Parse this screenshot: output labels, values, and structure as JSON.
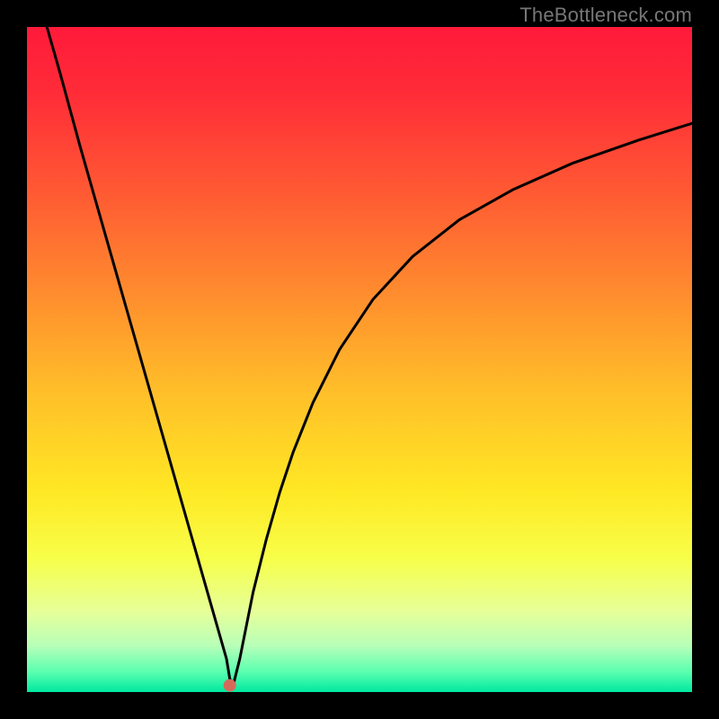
{
  "watermark": "TheBottleneck.com",
  "chart_data": {
    "type": "line",
    "title": "",
    "xlabel": "",
    "ylabel": "",
    "xlim": [
      0,
      100
    ],
    "ylim": [
      0,
      100
    ],
    "x": [
      3,
      5,
      8,
      10,
      12,
      15,
      18,
      20,
      22,
      25,
      27,
      28,
      29,
      30,
      30.5,
      31,
      32,
      34,
      36,
      38,
      40,
      43,
      47,
      52,
      58,
      65,
      73,
      82,
      92,
      100
    ],
    "values": [
      100,
      93,
      82,
      75,
      68,
      57.5,
      47,
      40,
      33,
      22.5,
      15.5,
      12,
      8.5,
      5,
      2,
      1,
      5,
      15,
      23,
      30,
      36,
      43.5,
      51.5,
      59,
      65.5,
      71,
      75.5,
      79.5,
      83,
      85.5
    ],
    "marker": {
      "x": 30.5,
      "y": 1,
      "color": "#d46b5a"
    },
    "gradient_stops": [
      {
        "offset": 0.0,
        "color": "#ff1a3a"
      },
      {
        "offset": 0.1,
        "color": "#ff2c38"
      },
      {
        "offset": 0.25,
        "color": "#ff5a33"
      },
      {
        "offset": 0.4,
        "color": "#ff8c2e"
      },
      {
        "offset": 0.55,
        "color": "#ffbf29"
      },
      {
        "offset": 0.7,
        "color": "#ffe824"
      },
      {
        "offset": 0.8,
        "color": "#f7ff4a"
      },
      {
        "offset": 0.88,
        "color": "#e6ff9a"
      },
      {
        "offset": 0.93,
        "color": "#b8ffb8"
      },
      {
        "offset": 0.97,
        "color": "#5affb0"
      },
      {
        "offset": 1.0,
        "color": "#00e8a0"
      }
    ]
  }
}
